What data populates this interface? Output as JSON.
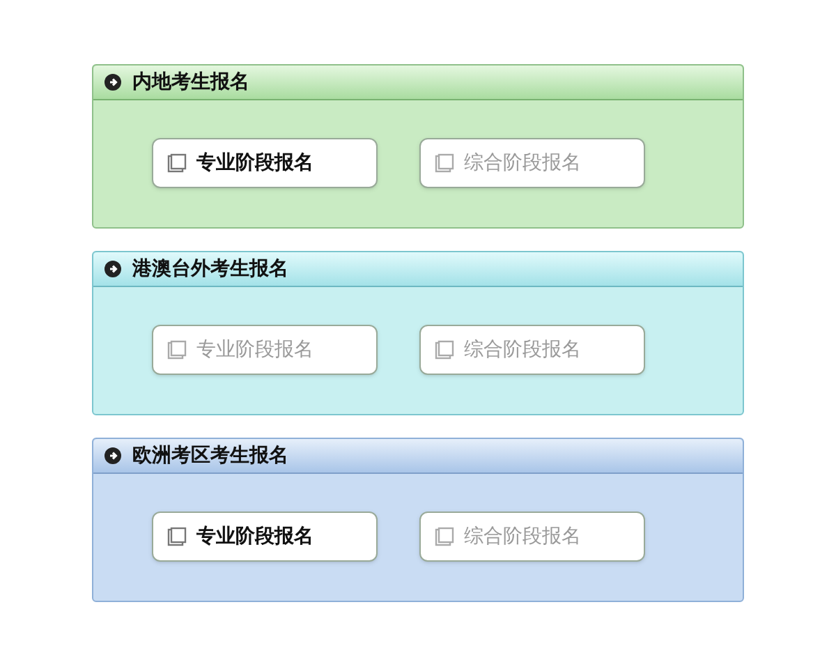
{
  "sections": [
    {
      "kind": "green",
      "title": "内地考生报名",
      "buttons": [
        {
          "label": "专业阶段报名",
          "disabled": false
        },
        {
          "label": "综合阶段报名",
          "disabled": true
        }
      ]
    },
    {
      "kind": "cyan",
      "title": "港澳台外考生报名",
      "buttons": [
        {
          "label": "专业阶段报名",
          "disabled": true
        },
        {
          "label": "综合阶段报名",
          "disabled": true
        }
      ]
    },
    {
      "kind": "blue",
      "title": "欧洲考区考生报名",
      "buttons": [
        {
          "label": "专业阶段报名",
          "disabled": false
        },
        {
          "label": "综合阶段报名",
          "disabled": true
        }
      ]
    }
  ]
}
